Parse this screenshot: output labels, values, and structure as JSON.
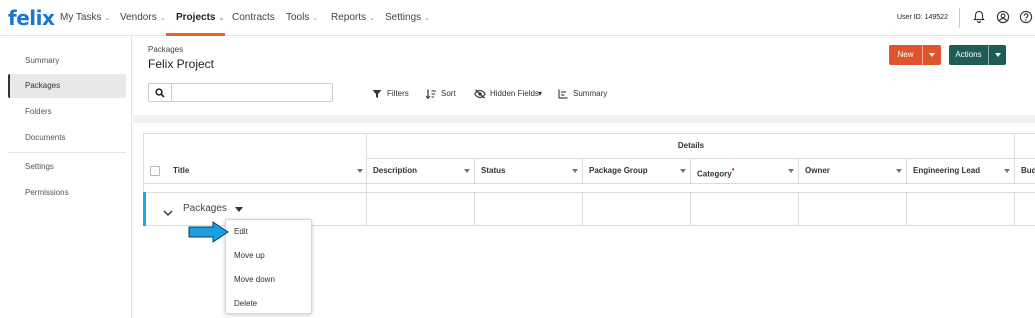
{
  "app": {
    "logo_text": "felix"
  },
  "nav": {
    "items": [
      {
        "label": "My Tasks",
        "has_menu": true
      },
      {
        "label": "Vendors",
        "has_menu": true
      },
      {
        "label": "Projects",
        "has_menu": true,
        "active": true
      },
      {
        "label": "Contracts",
        "has_menu": false
      },
      {
        "label": "Tools",
        "has_menu": true
      },
      {
        "label": "Reports",
        "has_menu": true
      },
      {
        "label": "Settings",
        "has_menu": true
      }
    ],
    "chevron_glyph": "⌄",
    "user_id": "User ID: 149522",
    "icons": [
      "bell-icon",
      "user-circle-icon",
      "help-circle-icon"
    ]
  },
  "sidebar": {
    "items": [
      {
        "label": "Summary"
      },
      {
        "label": "Packages",
        "active": true
      },
      {
        "label": "Folders"
      },
      {
        "label": "Documents"
      },
      {
        "label": "Settings"
      },
      {
        "label": "Permissions"
      }
    ]
  },
  "header": {
    "breadcrumb": "Packages",
    "title": "Felix Project",
    "new_label": "New",
    "actions_label": "Actions"
  },
  "toolbar": {
    "search_placeholder": "",
    "filters_label": "Filters",
    "sort_label": "Sort",
    "hidden_fields_label": "Hidden Fields",
    "hidden_fields_caret": "▾",
    "summary_label": "Summary"
  },
  "table": {
    "group_header": "Details",
    "columns": [
      {
        "label": "Title"
      },
      {
        "label": "Description"
      },
      {
        "label": "Status"
      },
      {
        "label": "Package Group"
      },
      {
        "label": "Category",
        "required_marker": "•"
      },
      {
        "label": "Owner"
      },
      {
        "label": "Engineering Lead"
      },
      {
        "label": "Bud"
      }
    ],
    "rows": [
      {
        "label": "Packages"
      }
    ]
  },
  "context_menu": {
    "items": [
      {
        "label": "Edit"
      },
      {
        "label": "Move up"
      },
      {
        "label": "Move down"
      },
      {
        "label": "Delete"
      }
    ]
  },
  "colors": {
    "brand": "#1976d2",
    "new_button": "#e0542b",
    "actions_button": "#1d5d56",
    "active_nav_underline": "#e8642a",
    "row_marker": "#1ea7e6",
    "pointer_arrow": "#1a9fe0"
  }
}
